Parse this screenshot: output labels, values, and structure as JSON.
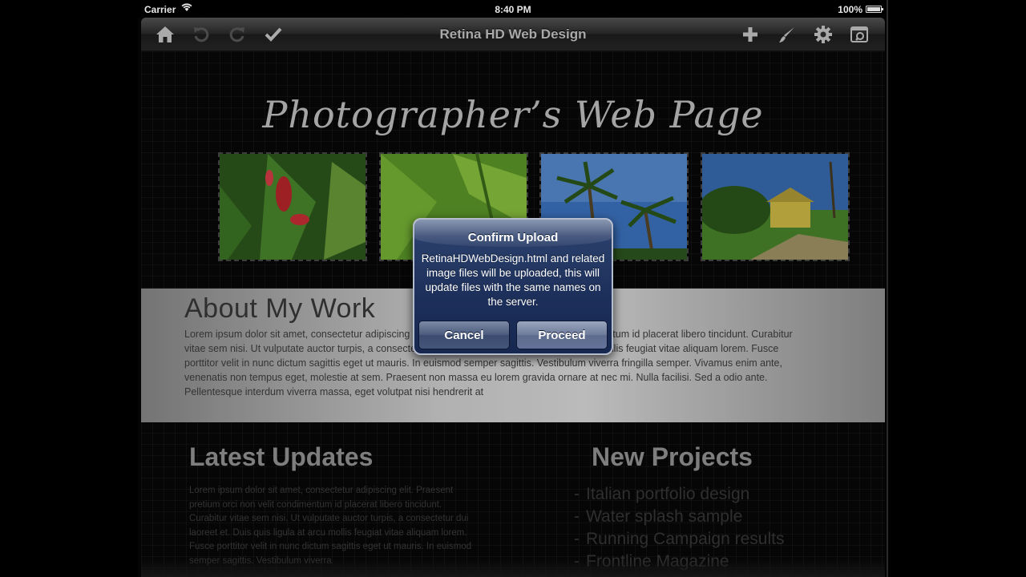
{
  "status_bar": {
    "carrier": "Carrier",
    "time": "8:40 PM",
    "battery": "100%"
  },
  "toolbar": {
    "title": "Retina HD Web Design",
    "left_icons": [
      "home-icon",
      "undo-icon",
      "redo-icon",
      "checkmark-icon"
    ],
    "right_icons": [
      "plus-icon",
      "brush-icon",
      "gear-icon",
      "preview-icon"
    ]
  },
  "webpage": {
    "site_title": "Photographer’s Web Page",
    "photos": [
      "red-flowers-photo",
      "bamboo-photo",
      "palm-trees-photo",
      "yellow-house-photo"
    ],
    "about": {
      "title": "About My Work",
      "text": "Lorem ipsum dolor sit amet, consectetur adipiscing elit. Praesent pretium orci non velit condimentum id placerat libero tincidunt. Curabitur vitae sem nisi. Ut vulputate auctor turpis, a consectetur dui laoreet et. Duis quis ligula at arcu mollis feugiat vitae aliquam lorem. Fusce porttitor velit in nunc dictum sagittis eget ut mauris. In euismod semper sagittis. Vestibulum viverra fringilla semper. Vivamus enim ante, venenatis non tempus eget, molestie at sem. Praesent non massa eu lorem gravida ornare at nec mi. Nulla facilisi. Sed a odio ante. Pellentesque interdum viverra massa, eget volutpat nisi hendrerit at"
    },
    "updates": {
      "title": "Latest Updates",
      "text": "Lorem ipsum dolor sit amet, consectetur adipiscing elit. Praesent pretium orci non velit condimentum id placerat libero tincidunt. Curabitur vitae sem nisi. Ut vulputate auctor turpis, a consectetur dui laoreet et. Duis quis ligula at arcu mollis feugiat vitae aliquam lorem. Fusce porttitor velit in nunc dictum sagittis eget ut mauris. In euismod semper sagittis. Vestibulum viverra"
    },
    "projects": {
      "title": "New Projects",
      "items": [
        "Italian portfolio design",
        "Water splash sample",
        "Running Campaign results",
        "Frontline Magazine"
      ]
    }
  },
  "alert": {
    "title": "Confirm Upload",
    "message": "RetinaHDWebDesign.html and related image files will be uploaded, this will update files with the same names on the server.",
    "cancel_label": "Cancel",
    "proceed_label": "Proceed"
  },
  "colors": {
    "alert_blue": "#1c2f5a",
    "toolbar": "#2c2c2c",
    "about_band": "#dcdcdc"
  }
}
